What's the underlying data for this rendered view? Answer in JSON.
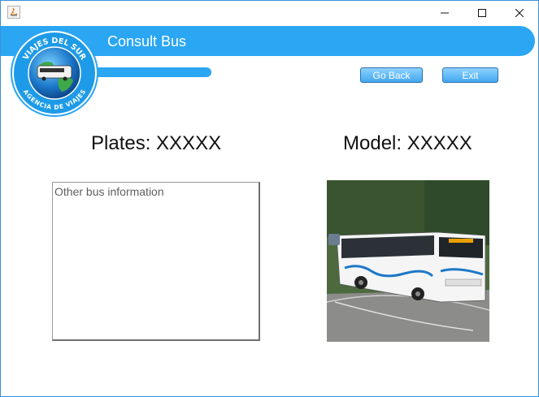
{
  "window": {
    "controls": {
      "minimize": "minimize-icon",
      "maximize": "maximize-icon",
      "close": "close-icon"
    }
  },
  "header": {
    "title": "Consult Bus"
  },
  "logo": {
    "top_text": "VIAJES DEL SUR",
    "bottom_text": "AGENCIA DE VIAJES"
  },
  "actions": {
    "go_back_label": "Go Back",
    "exit_label": "Exit"
  },
  "bus": {
    "plates_text": "Plates: XXXXX",
    "model_text": "Model: XXXXX",
    "info_text": "Other bus information"
  },
  "colors": {
    "accent": "#2aa6f3",
    "window_border": "#3c8fd8"
  }
}
